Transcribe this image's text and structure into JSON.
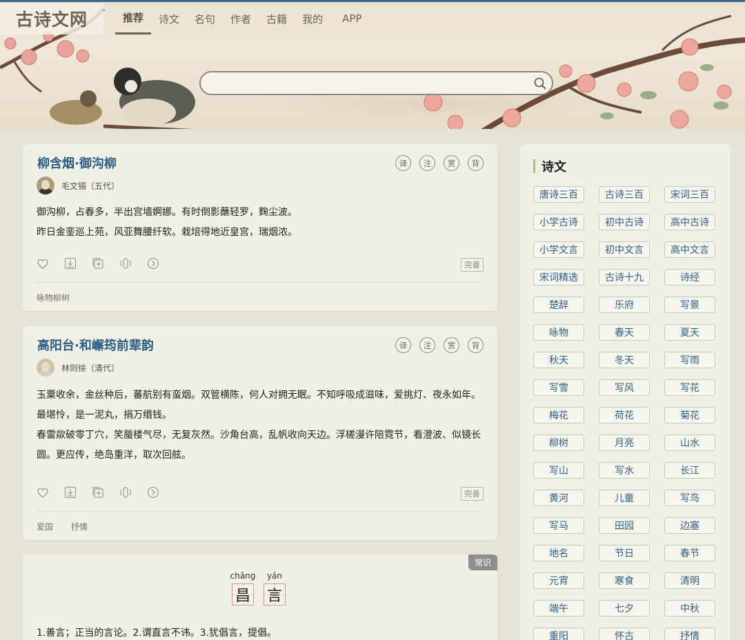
{
  "site": {
    "logo": "古诗文网"
  },
  "nav": {
    "items": [
      "推荐",
      "诗文",
      "名句",
      "作者",
      "古籍",
      "我的"
    ],
    "active_index": 0,
    "app_label": "APP"
  },
  "search": {
    "placeholder": "",
    "value": ""
  },
  "poems": [
    {
      "title": "柳含烟·御沟柳",
      "tools": [
        "译",
        "注",
        "赏",
        "背"
      ],
      "author": "毛文锡〔五代〕",
      "lines": [
        "御沟柳，占春多，半出宫墙婀娜。有时倒影蘸轻罗，麴尘波。",
        "昨日金銮巡上苑，风亚舞腰纤软。栽培得地近皇宫，瑞烟浓。"
      ],
      "perfect_label": "完善",
      "tags": [
        "咏物柳树"
      ]
    },
    {
      "title": "高阳台·和嶰筠前辈韵",
      "tools": [
        "译",
        "注",
        "赏",
        "背"
      ],
      "author": "林则徐〔清代〕",
      "lines": [
        "玉粟收余，金丝种后，蕃航别有蛮烟。双管横陈，何人对拥无眠。不知呼吸成滋味，爱挑灯、夜永如年。最堪怜，是一泥丸，捐万缗钱。",
        "春雷歘破零丁穴，笑蜃楼气尽，无复灰然。沙角台高，乱帆收向天边。浮槎漫许陪霓节，看澄波、似镜长圆。更应传，绝岛重洋，取次回舷。"
      ],
      "perfect_label": "完善",
      "tags": [
        "爱国",
        "抒情"
      ]
    }
  ],
  "knowledge": {
    "badge": "常识",
    "chars": [
      {
        "pinyin": "chāng",
        "hanzi": "昌"
      },
      {
        "pinyin": "yán",
        "hanzi": "言"
      }
    ],
    "meaning": "1.善言；正当的言论。2.谓直言不讳。3.犹倡言，提倡。"
  },
  "sidebar": {
    "title": "诗文",
    "tags": [
      "唐诗三百",
      "古诗三百",
      "宋词三百",
      "小学古诗",
      "初中古诗",
      "高中古诗",
      "小学文言",
      "初中文言",
      "高中文言",
      "宋词精选",
      "古诗十九",
      "诗经",
      "楚辞",
      "乐府",
      "写景",
      "咏物",
      "春天",
      "夏天",
      "秋天",
      "冬天",
      "写雨",
      "写雪",
      "写风",
      "写花",
      "梅花",
      "荷花",
      "菊花",
      "柳树",
      "月亮",
      "山水",
      "写山",
      "写水",
      "长江",
      "黄河",
      "儿童",
      "写鸟",
      "写马",
      "田园",
      "边塞",
      "地名",
      "节日",
      "春节",
      "元宵",
      "寒食",
      "清明",
      "端午",
      "七夕",
      "中秋",
      "重阳",
      "怀古",
      "抒情"
    ]
  },
  "colors": {
    "accent_blue": "#2c5d86",
    "background": "#e5e4d6",
    "card": "#f1f0e6",
    "sidebar_marker": "#a9c176"
  }
}
